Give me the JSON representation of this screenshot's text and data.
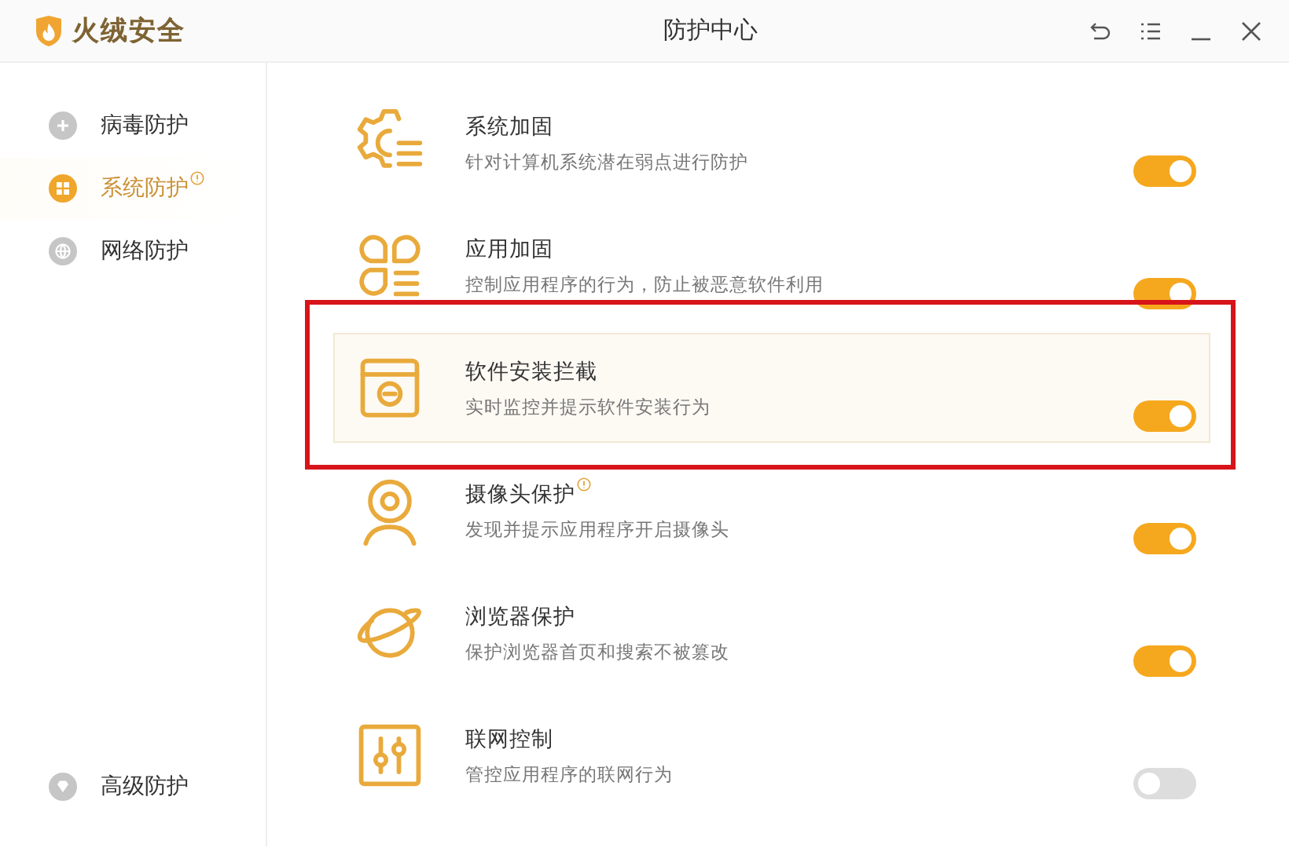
{
  "app": {
    "name": "火绒安全"
  },
  "window": {
    "title": "防护中心"
  },
  "sidebar": {
    "items": [
      {
        "label": "病毒防护",
        "selected": false,
        "alert": false
      },
      {
        "label": "系统防护",
        "selected": true,
        "alert": true
      },
      {
        "label": "网络防护",
        "selected": false,
        "alert": false
      }
    ],
    "bottom_item": {
      "label": "高级防护",
      "selected": false,
      "alert": false
    }
  },
  "features": [
    {
      "title": "系统加固",
      "description": "针对计算机系统潜在弱点进行防护",
      "on": true,
      "alert": false,
      "highlighted": false
    },
    {
      "title": "应用加固",
      "description": "控制应用程序的行为，防止被恶意软件利用",
      "on": true,
      "alert": false,
      "highlighted": false
    },
    {
      "title": "软件安装拦截",
      "description": "实时监控并提示软件安装行为",
      "on": true,
      "alert": false,
      "highlighted": true
    },
    {
      "title": "摄像头保护",
      "description": "发现并提示应用程序开启摄像头",
      "on": true,
      "alert": true,
      "highlighted": false
    },
    {
      "title": "浏览器保护",
      "description": "保护浏览器首页和搜索不被篡改",
      "on": true,
      "alert": false,
      "highlighted": false
    },
    {
      "title": "联网控制",
      "description": "管控应用程序的联网行为",
      "on": false,
      "alert": false,
      "highlighted": false
    }
  ]
}
